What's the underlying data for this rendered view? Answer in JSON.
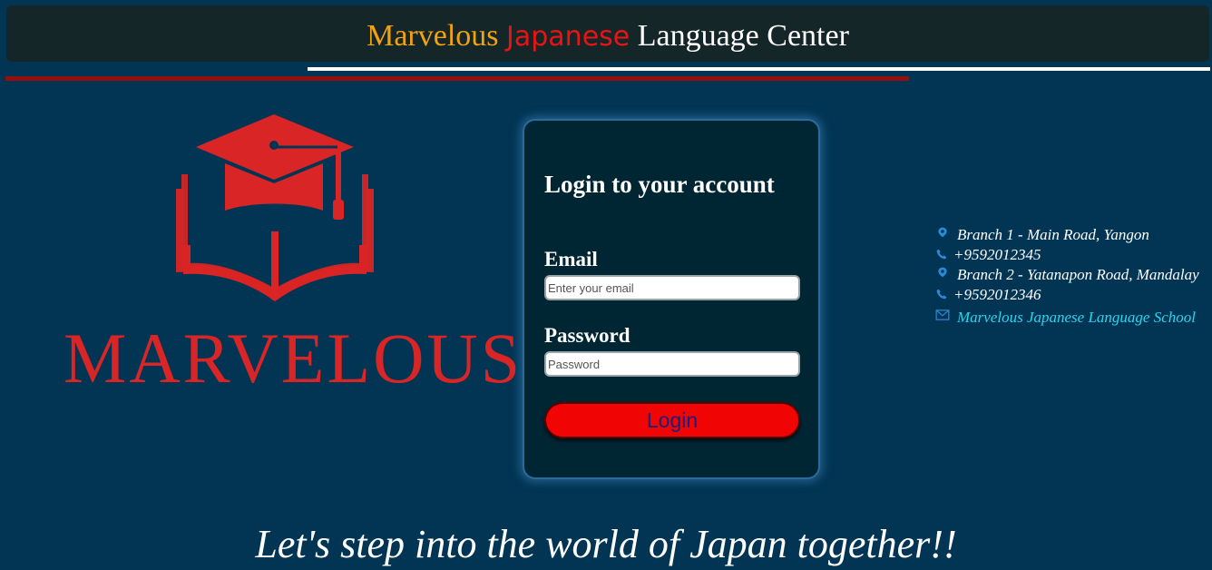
{
  "header": {
    "title_part1": "Marvelous",
    "title_part2": "Japanese",
    "title_part3": "Language Center"
  },
  "logo": {
    "wordmark": "MARVELOUS",
    "icon": "graduation-cap-book-icon"
  },
  "login": {
    "title": "Login to your account",
    "email_label": "Email",
    "email_placeholder": "Enter your email",
    "email_value": "",
    "password_label": "Password",
    "password_placeholder": "Password",
    "password_value": "",
    "button_label": "Login"
  },
  "contact": {
    "branch1_address": "Branch 1 - Main Road, Yangon",
    "branch1_phone": "+9592012345",
    "branch2_address": "Branch 2 - Yatanapon Road, Mandalay",
    "branch2_phone": "+9592012346",
    "email_link": "Marvelous Japanese Language School",
    "icons": [
      "location-pin-icon",
      "phone-icon",
      "location-pin-icon",
      "phone-icon",
      "envelope-icon"
    ]
  },
  "tagline": "Let's step into the world of Japan together!!",
  "colors": {
    "background": "#023553",
    "header_bg": "#152628",
    "accent_orange": "#f2a20f",
    "accent_red": "#e81414",
    "login_button": "#f00404",
    "link_cyan": "#22d8f0"
  }
}
